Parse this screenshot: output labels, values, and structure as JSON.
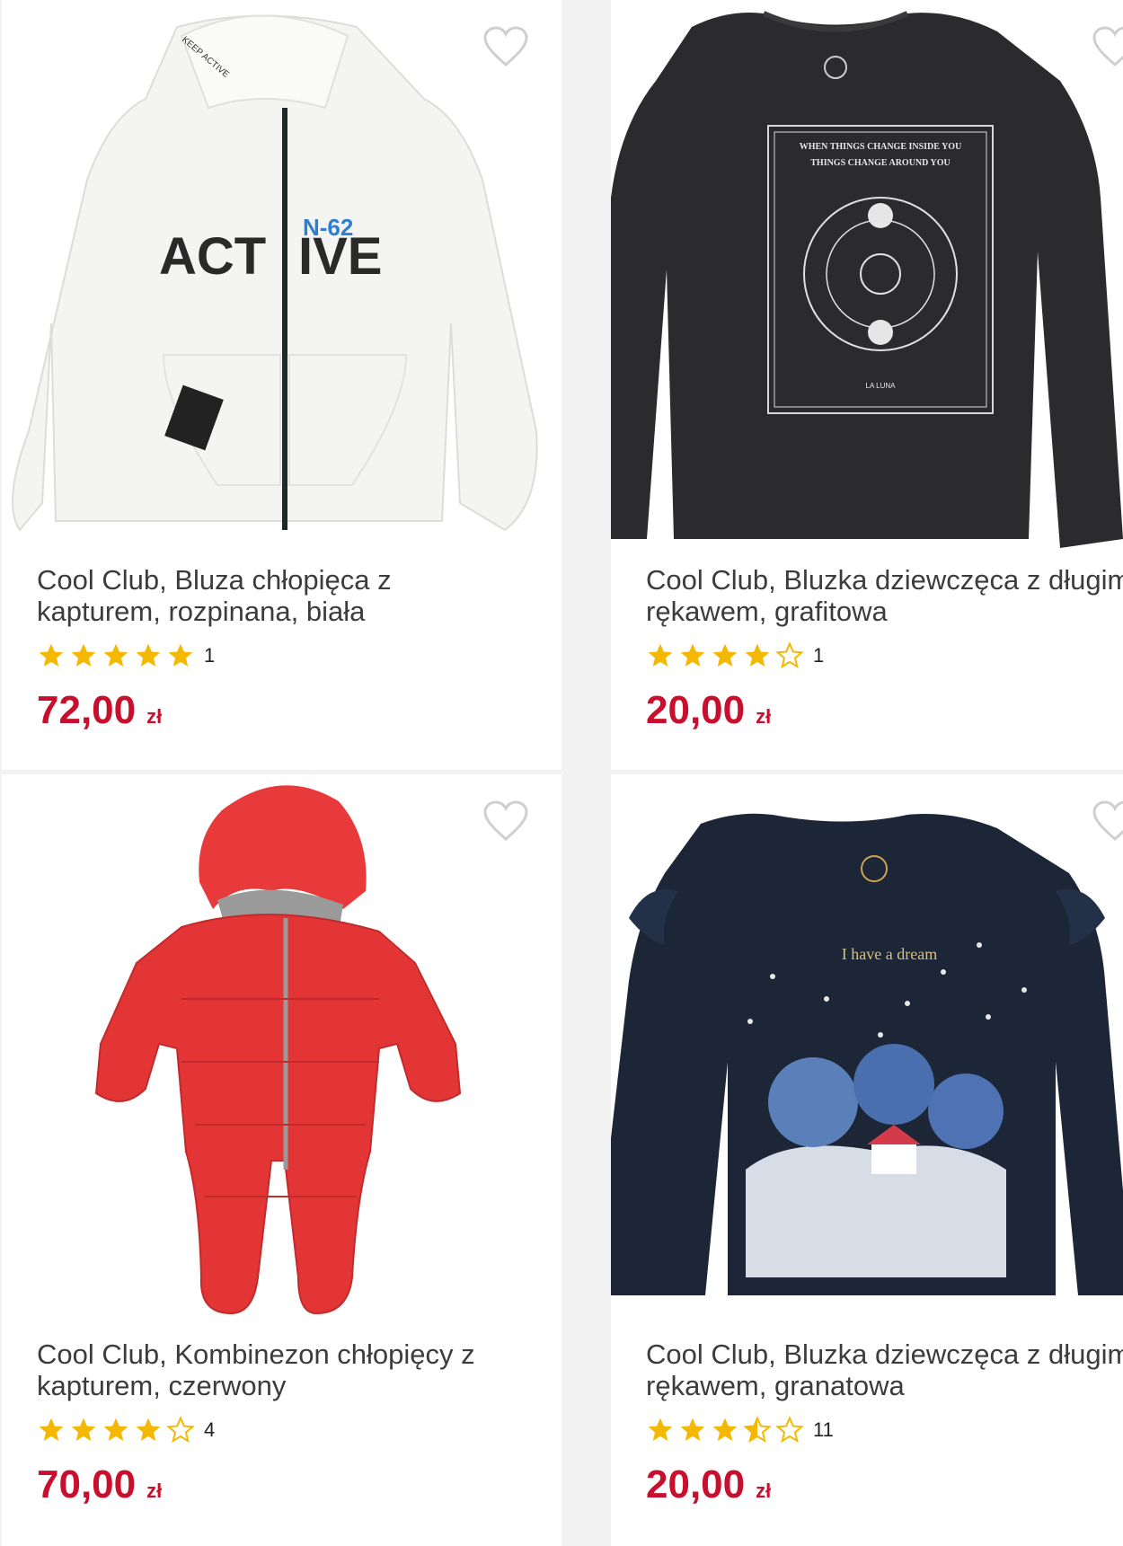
{
  "colors": {
    "price": "#c8102e",
    "star_filled": "#f5b800",
    "star_empty": "#f5b800",
    "title": "#3c3c3c"
  },
  "products": [
    {
      "title": "Cool Club, Bluza chłopięca z kapturem, rozpinana, biała",
      "rating": 5,
      "rating_count": "1",
      "price": "72,00",
      "currency": "zł",
      "image_text": [
        "ACT",
        "IVE",
        "N-62",
        "KEEP ACTIVE"
      ],
      "icon": "heart-icon"
    },
    {
      "title": "Cool Club, Bluzka dziewczęca z długim rękawem, grafitowa",
      "rating": 4,
      "rating_count": "1",
      "price": "20,00",
      "currency": "zł",
      "image_text": [
        "WHEN THINGS CHANGE INSIDE YOU",
        "THINGS CHANGE AROUND YOU",
        "LA LUNA"
      ],
      "icon": "heart-icon"
    },
    {
      "title": "Cool Club, Kombinezon chłopięcy z kapturem, czerwony",
      "rating": 4,
      "rating_count": "4",
      "price": "70,00",
      "currency": "zł",
      "image_text": [],
      "icon": "heart-icon"
    },
    {
      "title": "Cool Club, Bluzka dziewczęca z długim rękawem, granatowa",
      "rating": 3.5,
      "rating_count": "11",
      "price": "20,00",
      "currency": "zł",
      "image_text": [
        "I have a dream"
      ],
      "icon": "heart-icon"
    }
  ]
}
